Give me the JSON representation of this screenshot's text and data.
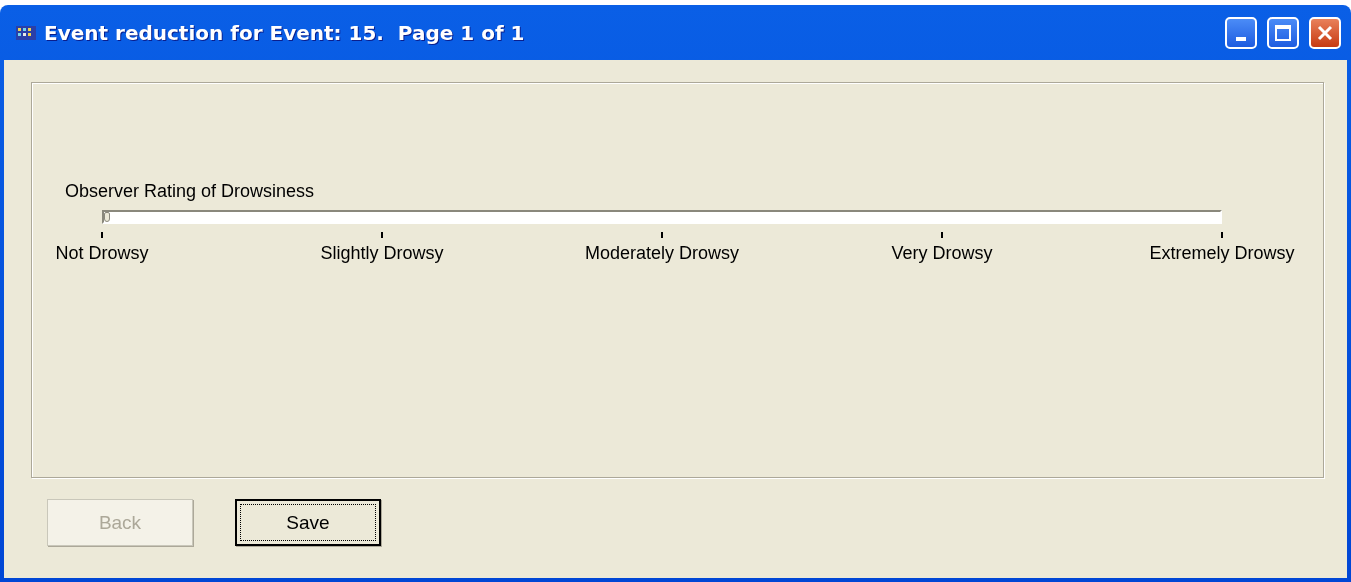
{
  "window": {
    "title": "Event reduction for Event: 15.  Page 1 of 1"
  },
  "slider": {
    "label": "Observer Rating of Drowsiness",
    "level": 0,
    "ticks": [
      "Not Drowsy",
      "Slightly Drowsy",
      "Moderately Drowsy",
      "Very Drowsy",
      "Extremely Drowsy"
    ]
  },
  "buttons": [
    {
      "label": "Back",
      "disabled": true,
      "default": false
    },
    {
      "label": "Save",
      "disabled": false,
      "default": true
    }
  ]
}
